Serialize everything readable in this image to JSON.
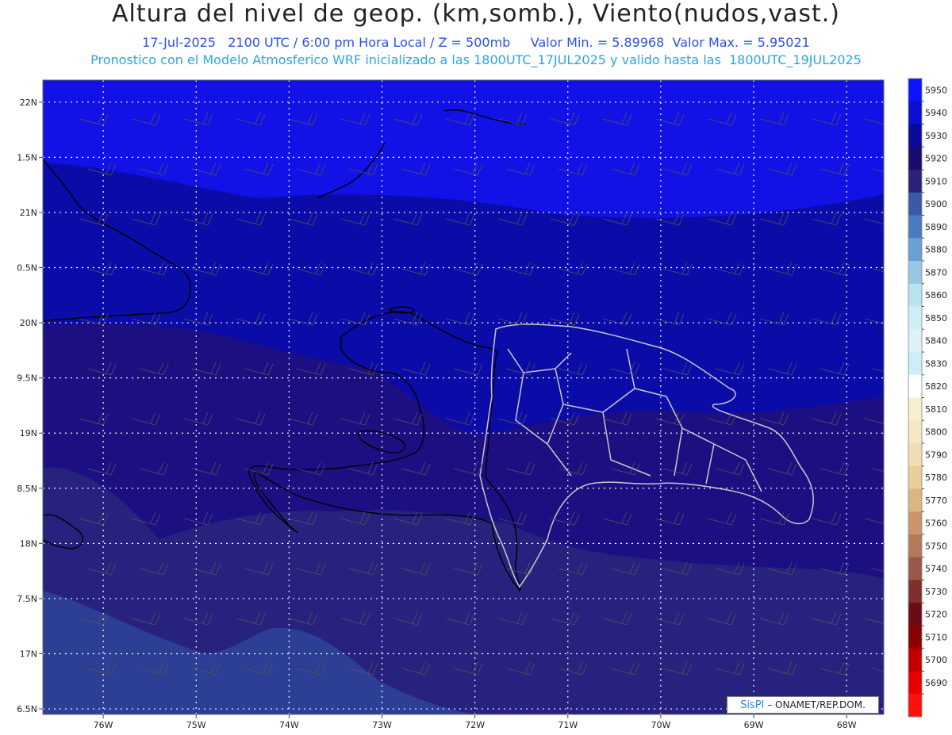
{
  "header": {
    "title": "Altura del nivel de geop. (km,somb.), Viento(nudos,vast.)",
    "subtitle1": "17-Jul-2025   2100 UTC / 6:00 pm Hora Local / Z = 500mb     Valor Min. = 5.89968  Valor Max. = 5.95021",
    "subtitle2": "Pronostico con el Modelo Atmosferico WRF inicializado a las 1800UTC_17JUL2025 y valido hasta las  1800UTC_19JUL2025"
  },
  "map": {
    "lon_labels": [
      "76W",
      "75W",
      "74W",
      "73W",
      "72W",
      "71W",
      "70W",
      "69W",
      "68W"
    ],
    "lat_labels": [
      "22N",
      "1.5N",
      "21N",
      "0.5N",
      "20N",
      "9.5N",
      "19N",
      "8.5N",
      "18N",
      "7.5N",
      "17N",
      "6.5N"
    ],
    "lon_range": [
      -76.65,
      -67.6
    ],
    "lat_range": [
      16.45,
      22.2
    ],
    "shade_colors": {
      "above_5940": "#1212e6",
      "5930_5940": "#0b0ba8",
      "5920_5930": "#1c0f82",
      "5910_5920": "#26227e",
      "5900_5910": "#2d3f94"
    },
    "coastline_color": "#000000",
    "border_color": "#c8c8c8",
    "grid_color": "#ffffff"
  },
  "colorbar": {
    "labels": [
      "5950",
      "5940",
      "5930",
      "5920",
      "5910",
      "5900",
      "5890",
      "5880",
      "5870",
      "5860",
      "5850",
      "5840",
      "5830",
      "5820",
      "5810",
      "5800",
      "5790",
      "5780",
      "5770",
      "5760",
      "5750",
      "5740",
      "5730",
      "5720",
      "5710",
      "5700",
      "5690"
    ],
    "colors": [
      "#0a14ff",
      "#0d0ed0",
      "#0c0a9a",
      "#190b6e",
      "#2b2178",
      "#3a5aa8",
      "#4a7cbf",
      "#6aa0d2",
      "#98c7e3",
      "#b9e3ef",
      "#cfeef5",
      "#dcf2f8",
      "#cbeff8",
      "#ffffff",
      "#f8efcf",
      "#f4e8c4",
      "#f0ddb2",
      "#e9cd9a",
      "#dcb680",
      "#c8966a",
      "#b27a58",
      "#9a5848",
      "#7e2f30",
      "#6a0c18",
      "#8a0000",
      "#c00000",
      "#e80000",
      "#ff1010"
    ]
  },
  "credit": {
    "logo": "SisPI",
    "text": "– ONAMET/REP.DOM."
  }
}
